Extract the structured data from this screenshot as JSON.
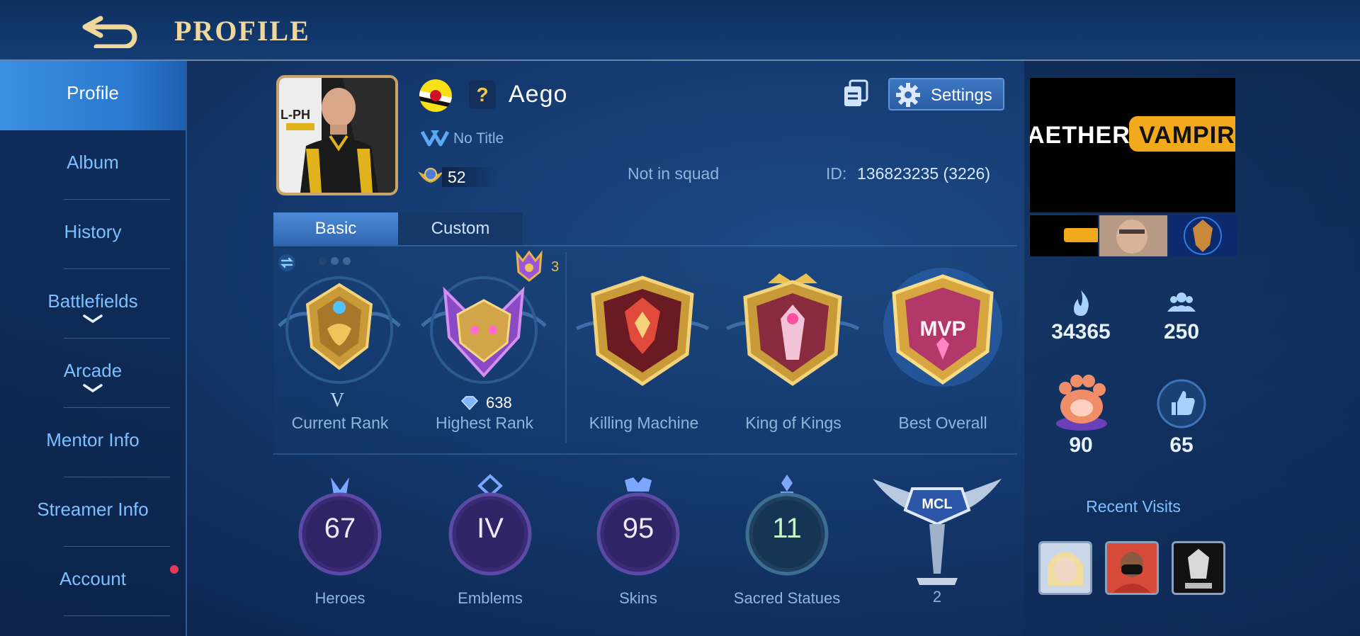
{
  "header": {
    "title": "PROFILE"
  },
  "sidebar": {
    "items": [
      {
        "label": "Profile"
      },
      {
        "label": "Album"
      },
      {
        "label": "History"
      },
      {
        "label": "Battlefields"
      },
      {
        "label": "Arcade"
      },
      {
        "label": "Mentor Info"
      },
      {
        "label": "Streamer Info"
      },
      {
        "label": "Account"
      }
    ]
  },
  "player": {
    "question": "?",
    "name": "Aego",
    "title": "No Title",
    "level": "52",
    "squad": "Not in squad",
    "id_label": "ID:",
    "id_value": "136823235 (3226)",
    "settings_label": "Settings"
  },
  "tabs": {
    "basic": "Basic",
    "custom": "Custom"
  },
  "ranks": {
    "current": {
      "label": "Current Rank",
      "tier": "V"
    },
    "highest": {
      "label": "Highest Rank",
      "stars": "638"
    },
    "crown_count": "3",
    "killing": {
      "label": "Killing Machine"
    },
    "king": {
      "label": "King of Kings"
    },
    "best": {
      "label": "Best Overall"
    }
  },
  "stats": {
    "heroes": {
      "value": "67",
      "label": "Heroes"
    },
    "emblems": {
      "value": "IV",
      "label": "Emblems"
    },
    "skins": {
      "value": "95",
      "label": "Skins"
    },
    "statues": {
      "value": "11",
      "label": "Sacred Statues"
    },
    "mcl": {
      "logo": "MCL",
      "value": "2"
    }
  },
  "right": {
    "banner_text_1": "AETHER",
    "banner_text_2": "VAMPIRE",
    "popularity": "34365",
    "followers": "250",
    "paw": "90",
    "likes": "65",
    "recent_visits": "Recent Visits"
  },
  "colors": {
    "accent_gold": "#f0d79c",
    "link_blue": "#7cc0ff",
    "active_tab": "#3b8fe0",
    "notify": "#e53a55"
  }
}
